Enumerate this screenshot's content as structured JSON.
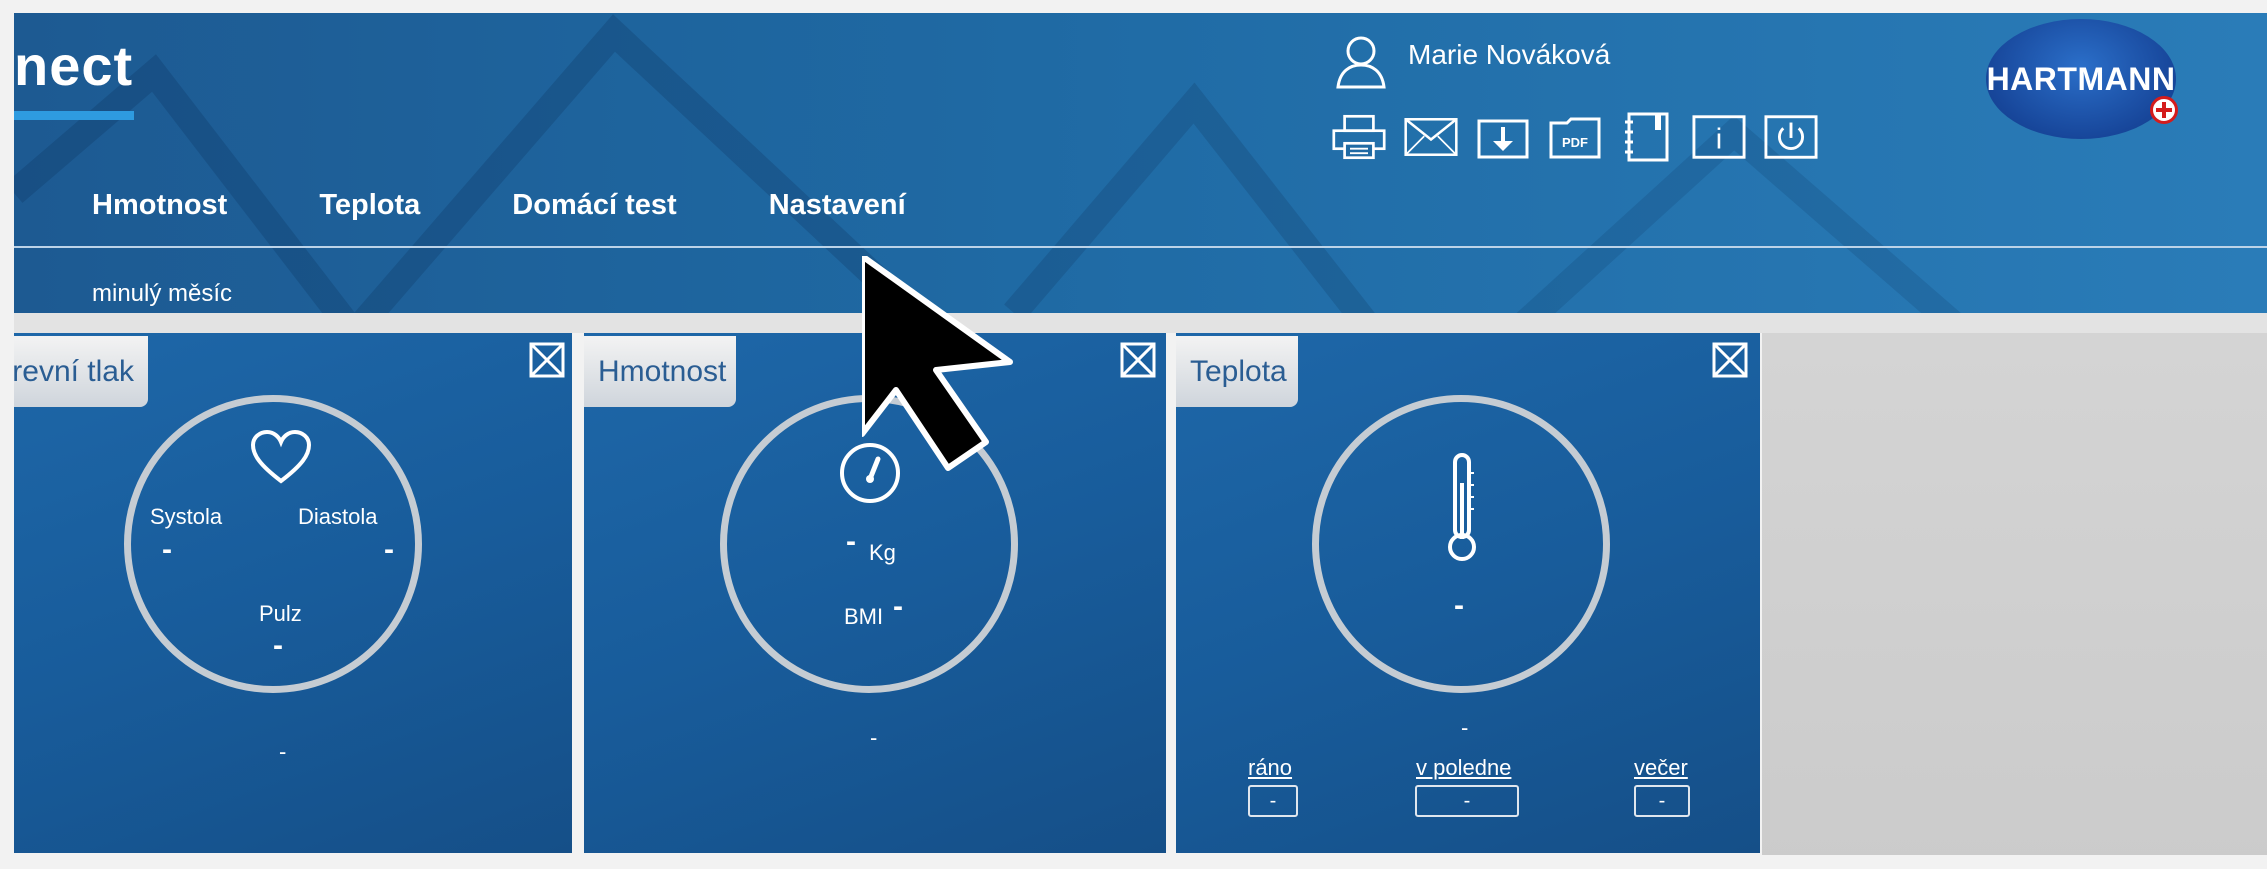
{
  "header": {
    "app_title": "nect",
    "user_name": "Marie Nováková",
    "logo_text": "HARTMANN",
    "nav": [
      "Hmotnost",
      "Teplota",
      "Domácí test",
      "Nastavení"
    ],
    "subnav": "minulý měsíc"
  },
  "toolbar": {
    "icons": [
      "printer-icon",
      "mail-icon",
      "download-icon",
      "pdf-icon",
      "notebook-icon",
      "info-icon",
      "power-icon"
    ],
    "pdf_label": "PDF",
    "info_label": "i"
  },
  "cards": {
    "pressure": {
      "title": "Krevní tlak",
      "systola_label": "Systola",
      "systola_value": "-",
      "diastola_label": "Diastola",
      "diastola_value": "-",
      "pulz_label": "Pulz",
      "pulz_value": "-",
      "footer_value": "-"
    },
    "weight": {
      "title": "Hmotnost",
      "kg_value": "-",
      "kg_unit": "Kg",
      "bmi_label": "BMI",
      "bmi_value": "-",
      "footer_value": "-"
    },
    "temperature": {
      "title": "Teplota",
      "value": "-",
      "footer_value": "-",
      "rano_label": "ráno",
      "rano_value": "-",
      "poledne_label": "v poledne",
      "poledne_value": "-",
      "vecer_label": "večer",
      "vecer_value": "-"
    }
  },
  "colors": {
    "header_blue": "#1f6aa4",
    "card_blue": "#185c9b",
    "accent": "#2e9be0",
    "tab_text": "#2a5d93"
  }
}
